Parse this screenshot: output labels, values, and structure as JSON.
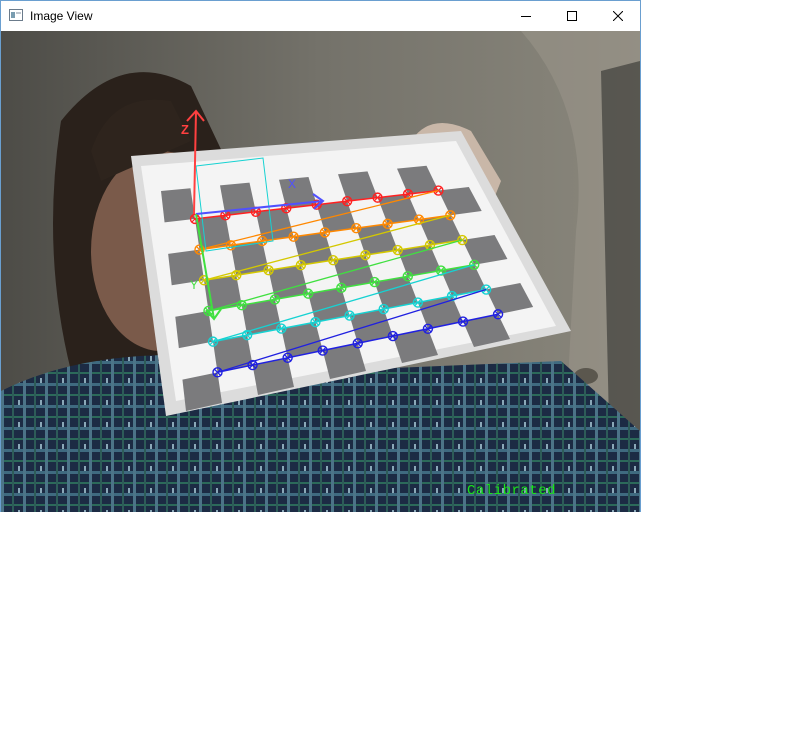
{
  "window": {
    "title": "Image View",
    "controls": {
      "minimize": "minimize-icon",
      "maximize": "maximize-icon",
      "close": "close-icon"
    }
  },
  "image": {
    "overlay_status": "Calibrated",
    "axis_labels": {
      "x": "X",
      "y": "Y",
      "z": "Z"
    },
    "row_colors": [
      "#ff2020",
      "#ff8800",
      "#d4c800",
      "#40e040",
      "#16d2d2",
      "#2020e0"
    ],
    "axis_colors": {
      "x": "#5050ff",
      "y": "#40e040",
      "z": "#ff4040"
    }
  }
}
